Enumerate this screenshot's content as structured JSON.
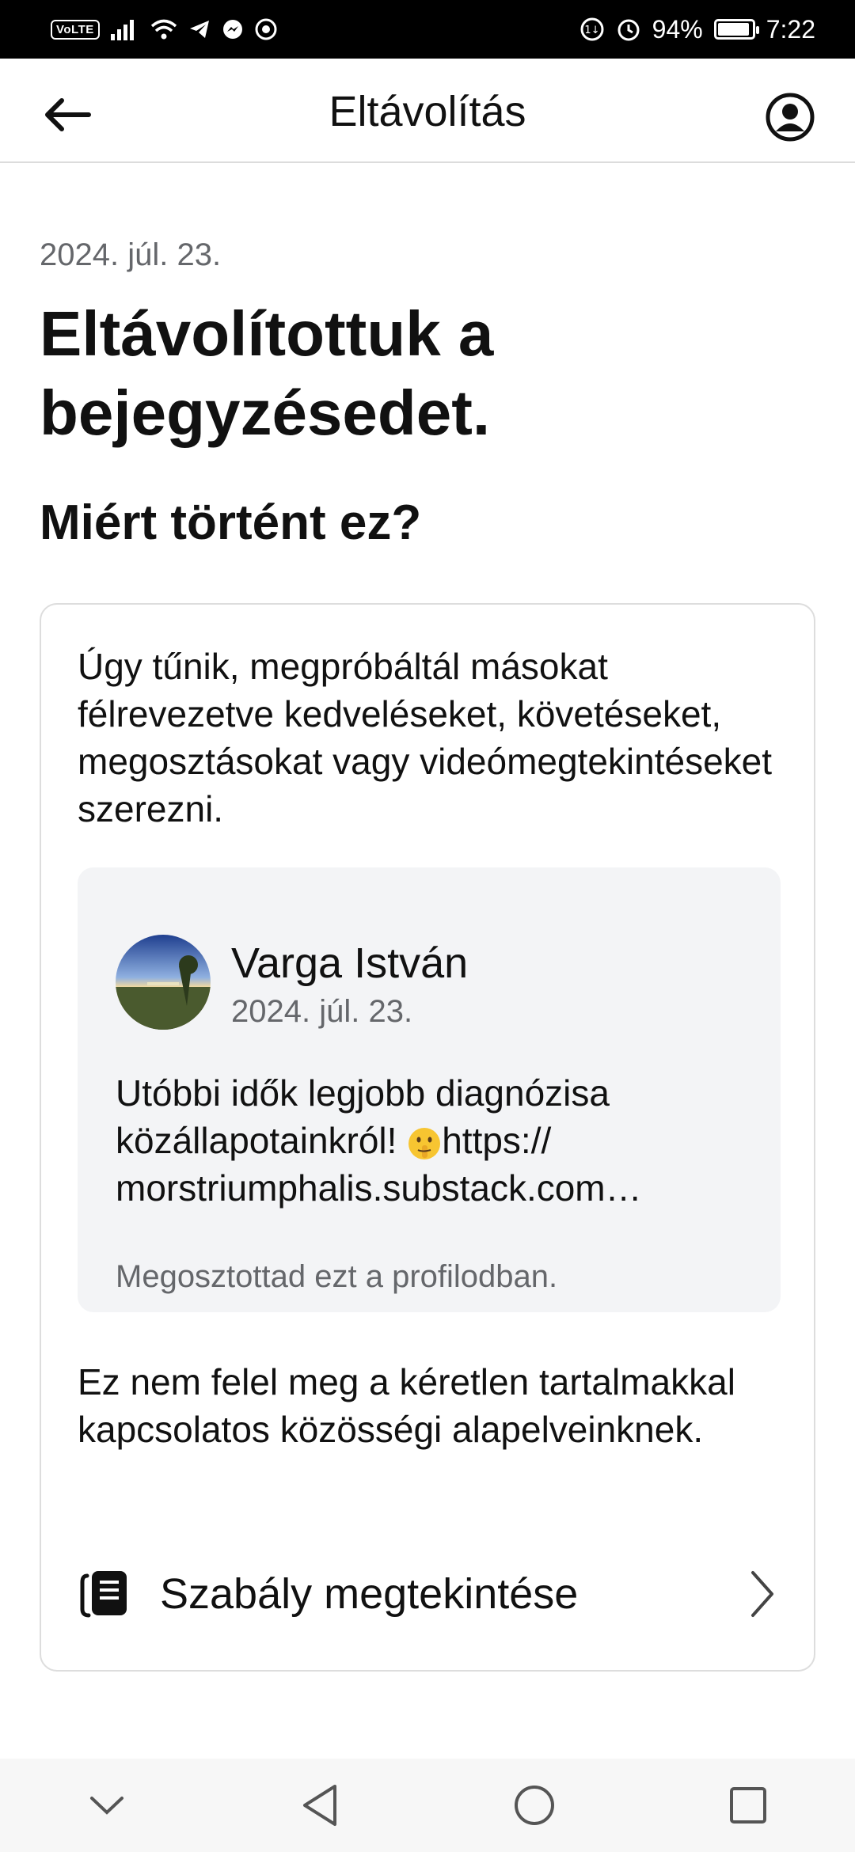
{
  "status_bar": {
    "volte": "VoLTE",
    "battery": "94%",
    "battery_level": 0.94,
    "time": "7:22"
  },
  "header": {
    "title": "Eltávolítás",
    "back_icon": "arrow-left-icon",
    "profile_icon": "account-circle-icon"
  },
  "content": {
    "date": "2024. júl. 23.",
    "title": "Eltávolítottuk a bejegyzésedet.",
    "why_heading": "Miért történt ez?",
    "card": {
      "explanation": "Úgy tűnik, megpróbáltál másokat félrevezetve kedveléseket, követéseket, megosztásokat vagy videómegtekintéseket szerezni.",
      "post": {
        "author": "Varga István",
        "date": "2024. júl. 23.",
        "text_line1": "Utóbbi idők legjobb diagnózisa",
        "text_line2_pre": "közállapotainkról! ",
        "emoji_icon": "shushing-face-icon",
        "text_line2_post": "https://",
        "text_line3": "morstriumphalis.substack.com…",
        "shared_note": "Megosztottad ezt a profilodban."
      },
      "policy_text": "Ez nem felel meg a kéretlen tartalmakkal kapcsolatos közösségi alapelveinknek.",
      "rule_link": {
        "label": "Szabály megtekintése",
        "icon": "book-icon",
        "chevron": "chevron-right-icon"
      }
    }
  },
  "nav_bar": {
    "items": [
      "chevron-down-icon",
      "back-triangle-icon",
      "home-circle-icon",
      "recents-square-icon"
    ]
  }
}
